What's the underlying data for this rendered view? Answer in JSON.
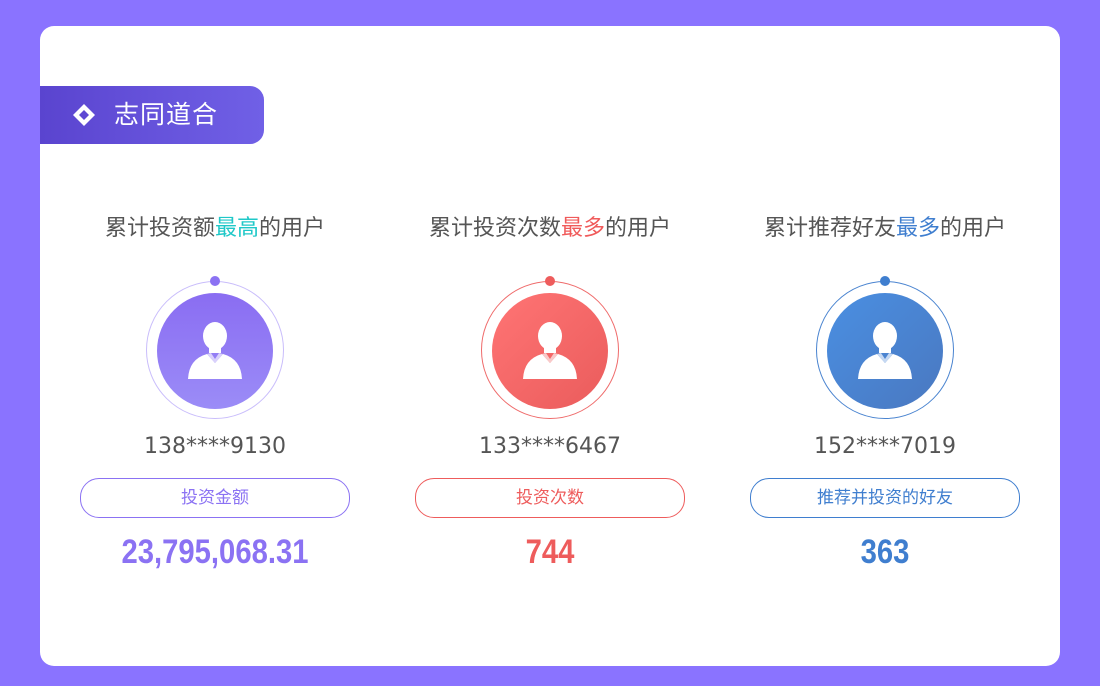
{
  "section": {
    "title": "志同道合",
    "icon": "diamond-icon"
  },
  "cards": [
    {
      "title_prefix": "累计投资额",
      "title_highlight": "最高",
      "title_suffix": "的用户",
      "highlight_color": "#1fc8c8",
      "phone": "138****9130",
      "metric_label": "投资金额",
      "metric_value": "23,795,068.31",
      "accent": "#8b72f3",
      "avatar_icon": "user-avatar-icon"
    },
    {
      "title_prefix": "累计投资次数",
      "title_highlight": "最多",
      "title_suffix": "的用户",
      "highlight_color": "#f05a5a",
      "phone": "133****6467",
      "metric_label": "投资次数",
      "metric_value": "744",
      "accent": "#ee5c5c",
      "avatar_icon": "user-avatar-icon"
    },
    {
      "title_prefix": "累计推荐好友",
      "title_highlight": "最多",
      "title_suffix": "的用户",
      "highlight_color": "#3f7ecf",
      "phone": "152****7019",
      "metric_label": "推荐并投资的好友",
      "metric_value": "363",
      "accent": "#3f7ecf",
      "avatar_icon": "user-avatar-icon"
    }
  ],
  "colors": {
    "page_background": "#8a73ff",
    "panel_background": "#ffffff",
    "tag_background": "#5a44cf",
    "text_gray": "#555555"
  }
}
